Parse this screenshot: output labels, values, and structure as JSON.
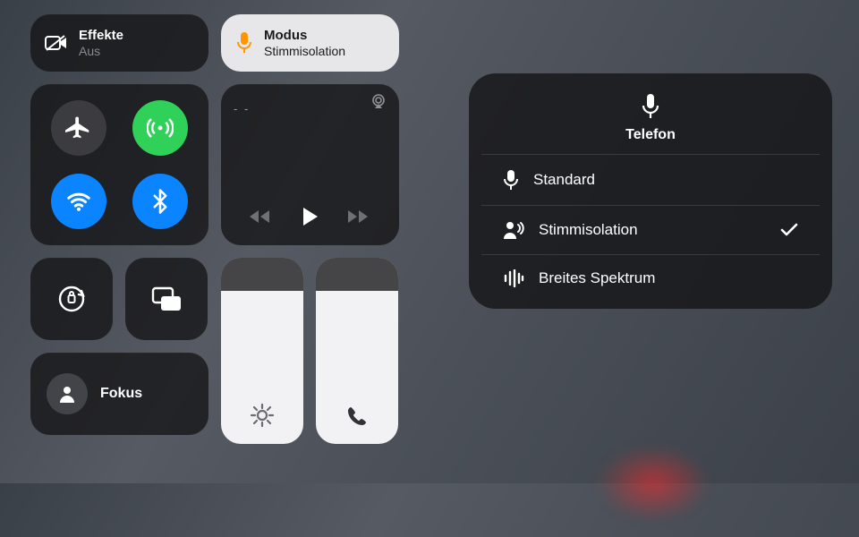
{
  "effects": {
    "title": "Effekte",
    "status": "Aus"
  },
  "mode": {
    "title": "Modus",
    "status": "Stimmisolation"
  },
  "media": {
    "title": "- -"
  },
  "focus": {
    "label": "Fokus"
  },
  "panel": {
    "title": "Telefon",
    "options": [
      {
        "label": "Standard",
        "selected": false
      },
      {
        "label": "Stimmisolation",
        "selected": true
      },
      {
        "label": "Breites Spektrum",
        "selected": false
      }
    ]
  },
  "colors": {
    "accent_orange": "#ff9500",
    "green": "#30d158",
    "blue": "#0a84ff"
  }
}
